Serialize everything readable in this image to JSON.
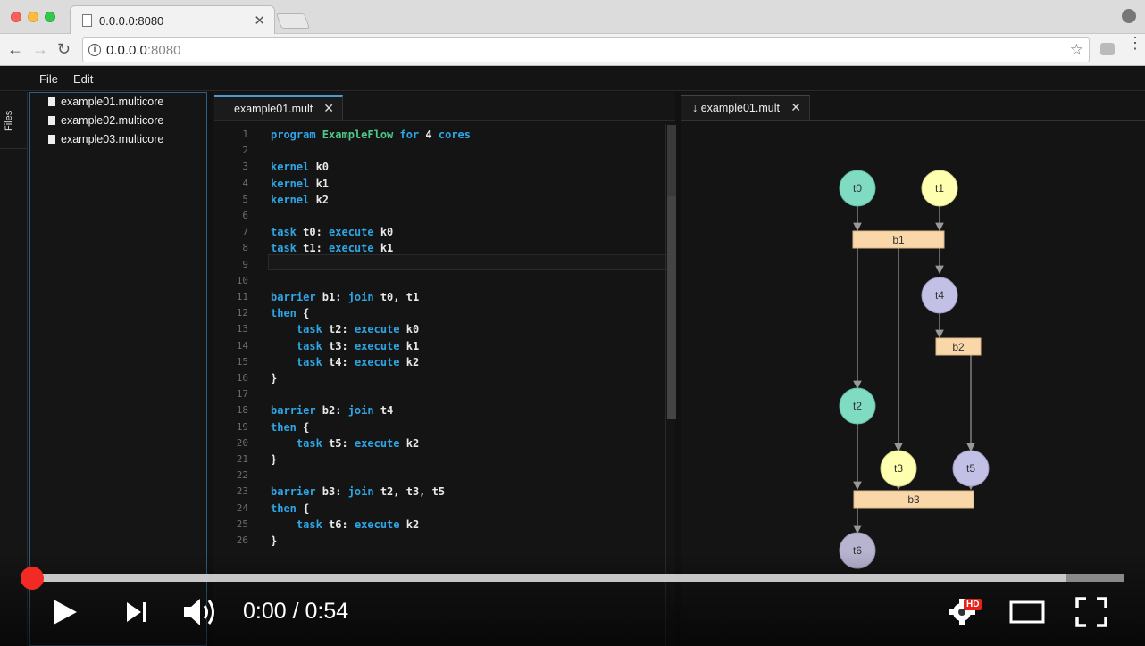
{
  "browser": {
    "tab_title": "0.0.0.0:8080",
    "tab_close": "✕",
    "url_host": "0.0.0.0",
    "url_port": ":8080",
    "info_glyph": "i",
    "star_glyph": "☆",
    "back_glyph": "←",
    "forward_glyph": "→",
    "reload_glyph": "↻",
    "menu_glyph": "⋮"
  },
  "menubar": {
    "file": "File",
    "edit": "Edit"
  },
  "sidebar": {
    "files_label": "Files",
    "items": [
      {
        "label": "example01.multicore"
      },
      {
        "label": "example02.multicore"
      },
      {
        "label": "example03.multicore"
      }
    ]
  },
  "editor": {
    "tab_title": "example01.mult",
    "tab_close": "✕",
    "line_numbers": [
      "1",
      "2",
      "3",
      "4",
      "5",
      "6",
      "7",
      "8",
      "9",
      "10",
      "11",
      "12",
      "13",
      "14",
      "15",
      "16",
      "17",
      "18",
      "19",
      "20",
      "21",
      "22",
      "23",
      "24",
      "25",
      "26"
    ],
    "lines": [
      [
        [
          "kw",
          "program "
        ],
        [
          "nm",
          "ExampleFlow"
        ],
        [
          "kw",
          " for "
        ],
        [
          "t",
          "4"
        ],
        [
          "kw",
          " cores"
        ]
      ],
      [],
      [
        [
          "kw",
          "kernel "
        ],
        [
          "t",
          "k0"
        ]
      ],
      [
        [
          "kw",
          "kernel "
        ],
        [
          "t",
          "k1"
        ]
      ],
      [
        [
          "kw",
          "kernel "
        ],
        [
          "t",
          "k2"
        ]
      ],
      [],
      [
        [
          "kw",
          "task "
        ],
        [
          "t",
          "t0: "
        ],
        [
          "kw",
          "execute "
        ],
        [
          "t",
          "k0"
        ]
      ],
      [
        [
          "kw",
          "task "
        ],
        [
          "t",
          "t1: "
        ],
        [
          "kw",
          "execute "
        ],
        [
          "t",
          "k1"
        ]
      ],
      [],
      [],
      [
        [
          "kw",
          "barrier "
        ],
        [
          "t",
          "b1: "
        ],
        [
          "kw",
          "join "
        ],
        [
          "t",
          "t0, t1"
        ]
      ],
      [
        [
          "kw",
          "then "
        ],
        [
          "t",
          "{"
        ]
      ],
      [
        [
          "t",
          "    "
        ],
        [
          "kw",
          "task "
        ],
        [
          "t",
          "t2: "
        ],
        [
          "kw",
          "execute "
        ],
        [
          "t",
          "k0"
        ]
      ],
      [
        [
          "t",
          "    "
        ],
        [
          "kw",
          "task "
        ],
        [
          "t",
          "t3: "
        ],
        [
          "kw",
          "execute "
        ],
        [
          "t",
          "k1"
        ]
      ],
      [
        [
          "t",
          "    "
        ],
        [
          "kw",
          "task "
        ],
        [
          "t",
          "t4: "
        ],
        [
          "kw",
          "execute "
        ],
        [
          "t",
          "k2"
        ]
      ],
      [
        [
          "t",
          "}"
        ]
      ],
      [],
      [
        [
          "kw",
          "barrier "
        ],
        [
          "t",
          "b2: "
        ],
        [
          "kw",
          "join "
        ],
        [
          "t",
          "t4"
        ]
      ],
      [
        [
          "kw",
          "then "
        ],
        [
          "t",
          "{"
        ]
      ],
      [
        [
          "t",
          "    "
        ],
        [
          "kw",
          "task "
        ],
        [
          "t",
          "t5: "
        ],
        [
          "kw",
          "execute "
        ],
        [
          "t",
          "k2"
        ]
      ],
      [
        [
          "t",
          "}"
        ]
      ],
      [],
      [
        [
          "kw",
          "barrier "
        ],
        [
          "t",
          "b3: "
        ],
        [
          "kw",
          "join "
        ],
        [
          "t",
          "t2, t3, t5"
        ]
      ],
      [
        [
          "kw",
          "then "
        ],
        [
          "t",
          "{"
        ]
      ],
      [
        [
          "t",
          "    "
        ],
        [
          "kw",
          "task "
        ],
        [
          "t",
          "t6: "
        ],
        [
          "kw",
          "execute "
        ],
        [
          "t",
          "k2"
        ]
      ],
      [
        [
          "t",
          "}"
        ]
      ]
    ]
  },
  "graph": {
    "tab_title": "↓ example01.mult",
    "tab_close": "✕",
    "nodes": [
      {
        "id": "t0",
        "color": "#7fdbc1"
      },
      {
        "id": "t1",
        "color": "#ffffb0"
      },
      {
        "id": "t4",
        "color": "#c3c0e6"
      },
      {
        "id": "t2",
        "color": "#7fdbc1"
      },
      {
        "id": "t3",
        "color": "#ffffb0"
      },
      {
        "id": "t5",
        "color": "#c3c0e6"
      },
      {
        "id": "t6",
        "color": "#b7b4d0"
      }
    ],
    "barriers": [
      {
        "id": "b1",
        "color": "#fad7a8"
      },
      {
        "id": "b2",
        "color": "#fad7a8"
      },
      {
        "id": "b3",
        "color": "#fad7a8"
      }
    ]
  },
  "video": {
    "time": "0:00 / 0:54",
    "hd_badge": "HD",
    "progress_played": 0.0,
    "progress_loaded": 0.947,
    "accent": "#f12b24"
  }
}
